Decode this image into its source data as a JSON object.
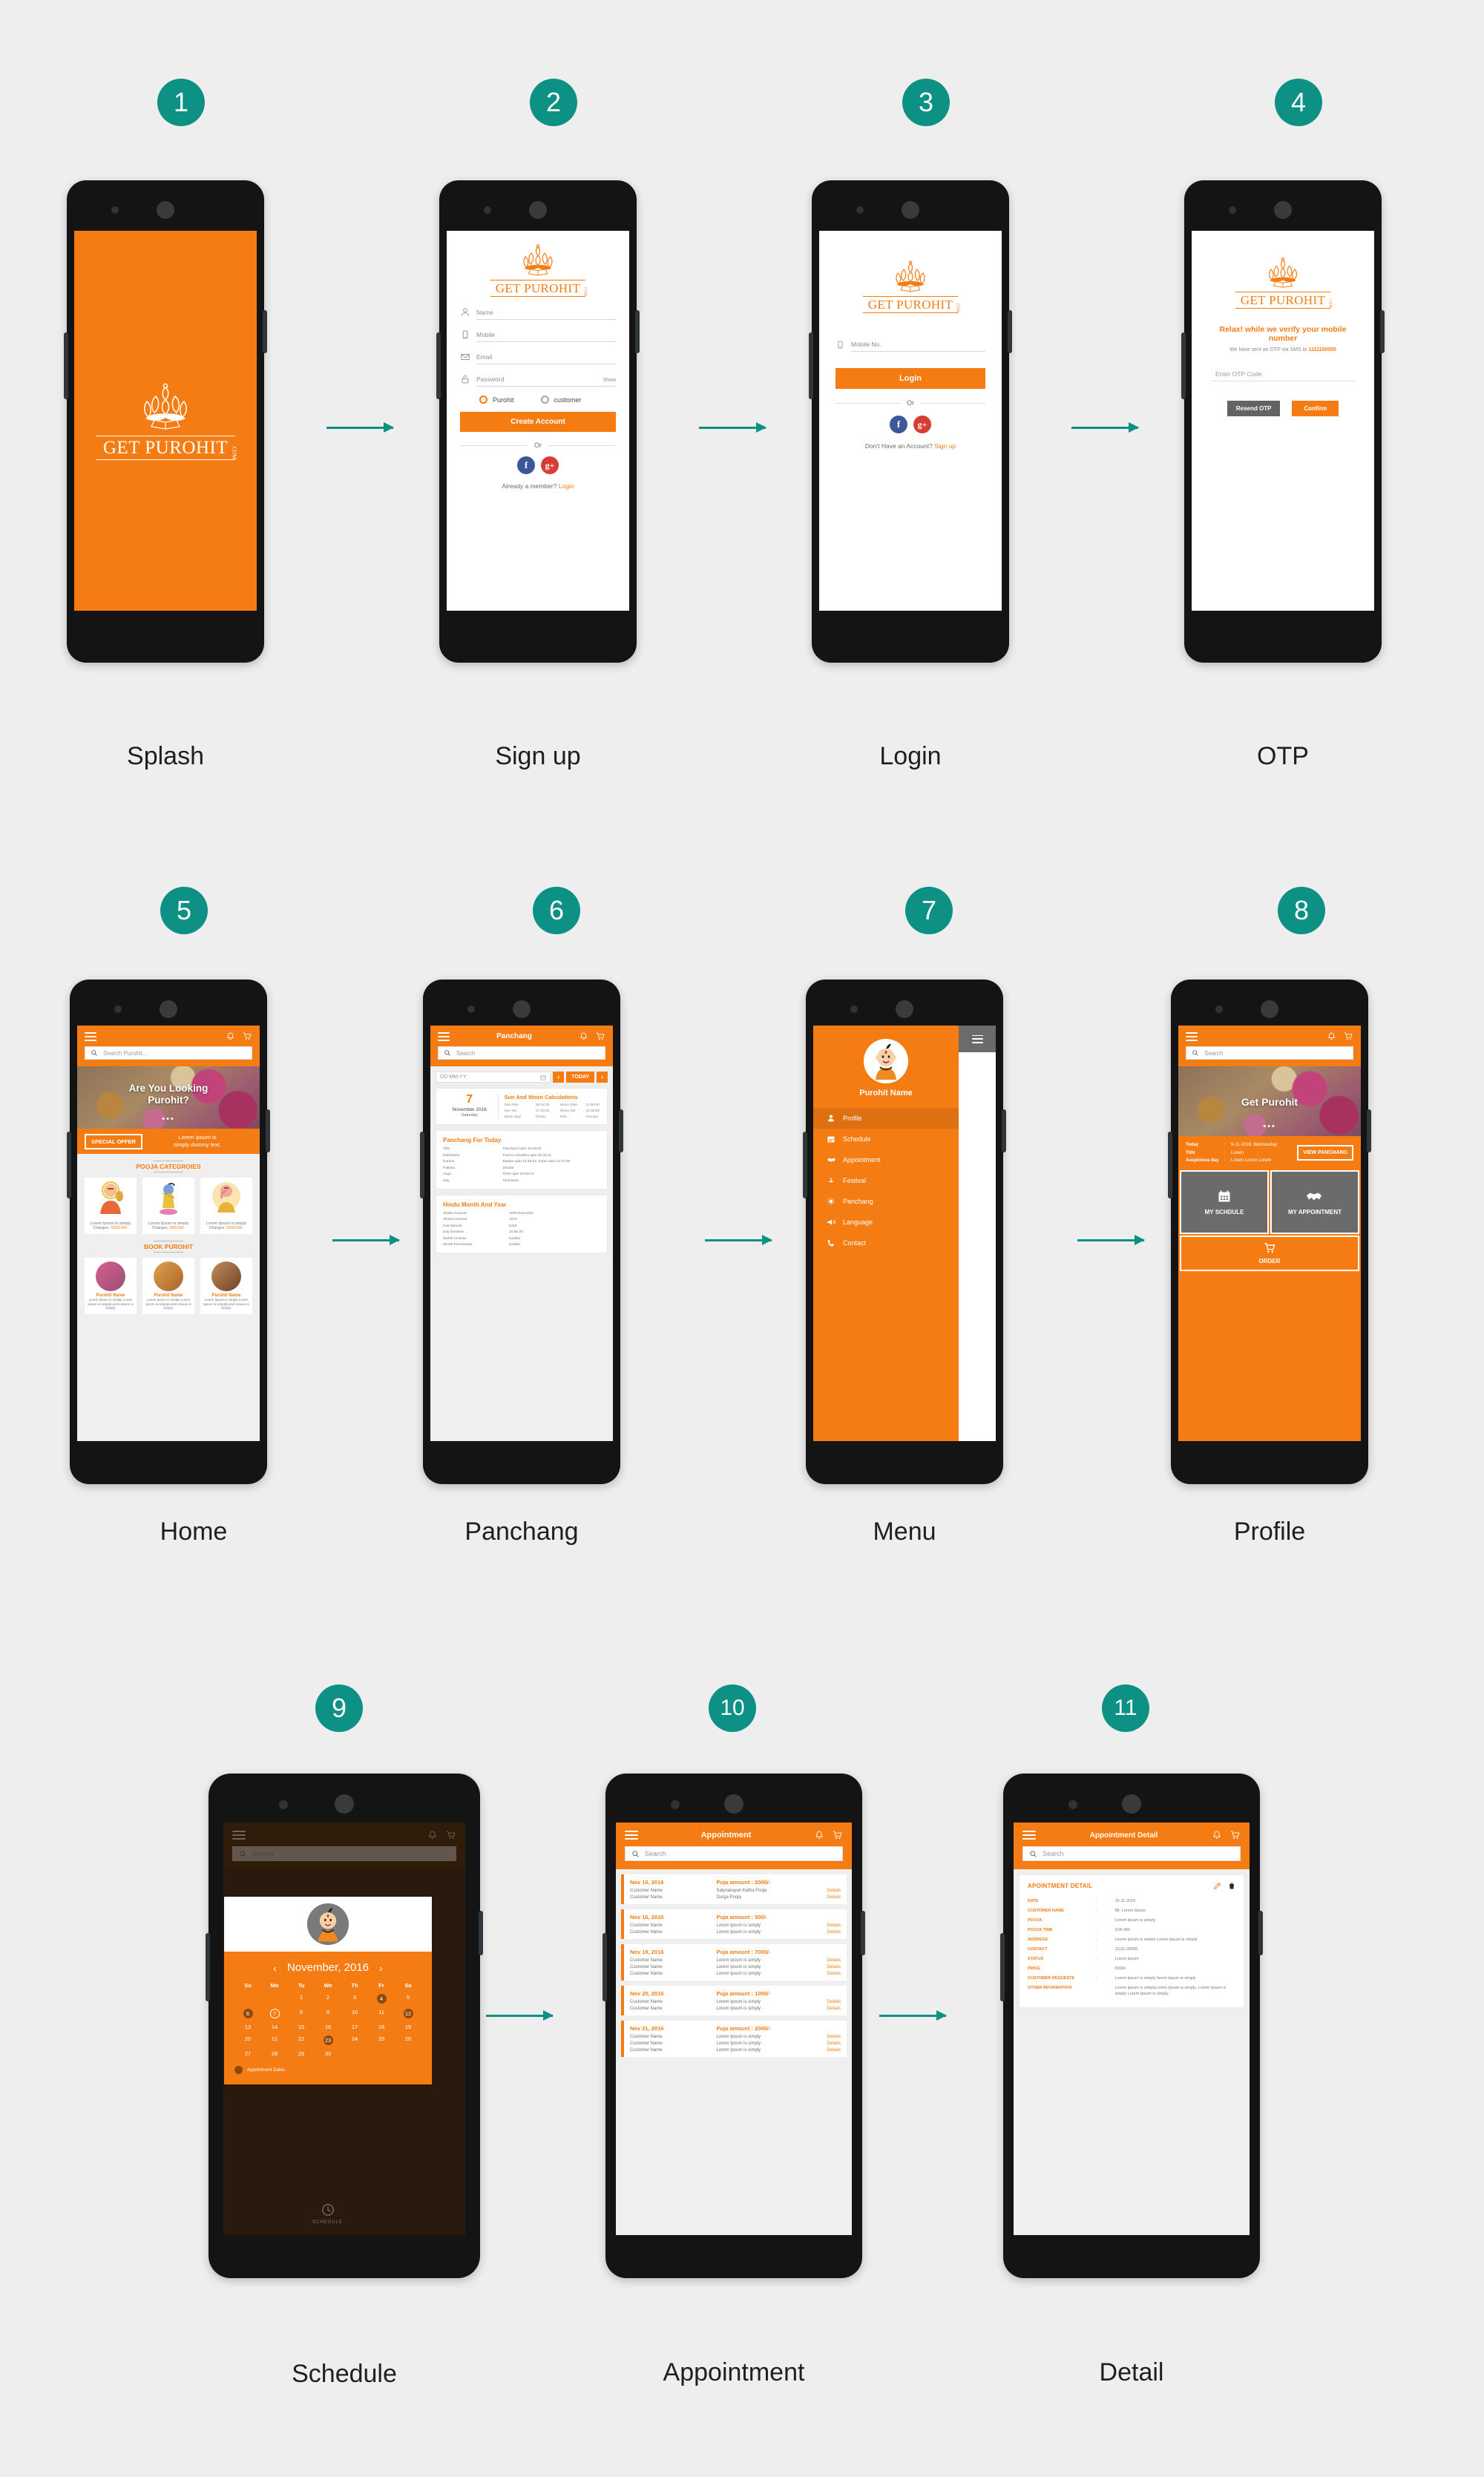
{
  "brand": {
    "accent_orange": "#f57c13",
    "teal": "#0d9184",
    "logo_word": "GET PUROHIT",
    "logo_suffix": ".COM"
  },
  "flow": [
    {
      "number": "1",
      "caption": "Splash"
    },
    {
      "number": "2",
      "caption": "Sign up"
    },
    {
      "number": "3",
      "caption": "Login"
    },
    {
      "number": "4",
      "caption": "OTP"
    },
    {
      "number": "5",
      "caption": "Home"
    },
    {
      "number": "6",
      "caption": "Panchang"
    },
    {
      "number": "7",
      "caption": "Menu"
    },
    {
      "number": "8",
      "caption": "Profile"
    },
    {
      "number": "9",
      "caption": "Schedule"
    },
    {
      "number": "10",
      "caption": "Appointment"
    },
    {
      "number": "11",
      "caption": "Detail"
    }
  ],
  "signup": {
    "fields": [
      {
        "icon": "user-icon",
        "placeholder": "Name"
      },
      {
        "icon": "mobile-icon",
        "placeholder": "Mobile"
      },
      {
        "icon": "envelope-icon",
        "placeholder": "Email"
      },
      {
        "icon": "lock-icon",
        "placeholder": "Password"
      }
    ],
    "show_label": "Show",
    "role_purohit": "Purohit",
    "role_customer": "customer",
    "create_button": "Create Account",
    "or_label": "Or",
    "social": [
      {
        "name": "facebook-icon",
        "glyph": "f"
      },
      {
        "name": "google-plus-icon",
        "glyph": "g+"
      }
    ],
    "footer_text": "Already a member?",
    "footer_link": "Login"
  },
  "login": {
    "mobile_placeholder": "Mobile No.",
    "login_button": "Login",
    "or_label": "Or",
    "social": [
      {
        "name": "facebook-icon",
        "glyph": "f"
      },
      {
        "name": "google-plus-icon",
        "glyph": "g+"
      }
    ],
    "footer_text": "Don't Have an Account?",
    "footer_link": "Sign up"
  },
  "otp": {
    "headline": "Relax! while we verify your mobile number",
    "subtext_prefix": "We have sent an OTP via SMS to",
    "number": "1111100000",
    "otp_placeholder": "Enter OTP Code",
    "resend_button": "Resend OTP",
    "confirm_button": "Confirm"
  },
  "home": {
    "search_placeholder": "Search Purohit...",
    "hero_title_line1": "Are You Looking",
    "hero_title_line2": "Purohit?",
    "offer_button": "SPECIAL OFFER",
    "offer_text_line1": "Lorem Ipsum is",
    "offer_text_line2": "simply dummy text.",
    "section_pooja": "POOJA CATEGROIES",
    "section_book": "BOOK PUROHIT",
    "pooja_cards": [
      {
        "deity": "hanuman",
        "desc": "Lorem Ipsum is simply",
        "charge_label": "Charges :",
        "charge": "1000.00/-"
      },
      {
        "deity": "krishna",
        "desc": "Lorem Ipsum is simply",
        "charge_label": "Charges :",
        "charge": "500.00/-"
      },
      {
        "deity": "ganesh",
        "desc": "Lorem Ipsum is simply",
        "charge_label": "Charges :",
        "charge": "1500.00/-"
      }
    ],
    "purohit_cards": [
      {
        "name": "Purohit Name",
        "desc": "Lorem Ipsum is simply Lorem Ipsum is simplyLorem Ipsum is simply."
      },
      {
        "name": "Purohit Name",
        "desc": "Lorem Ipsum is simply Lorem Ipsum is simplyLorem Ipsum is simply."
      },
      {
        "name": "Purohit Name",
        "desc": "Lorem Ipsum is simply Lorem Ipsum is simplyLorem Ipsum is simply."
      }
    ]
  },
  "panchang": {
    "title": "Panchang",
    "search_placeholder": "Search",
    "date_placeholder": "DD-MM-YY",
    "prev": "‹",
    "today": "TODAY",
    "next": "›",
    "day_number": "7",
    "month_year": "November 2016",
    "weekday": "Saturday",
    "sun_moon_title": "Sun And Moon Calculations",
    "sun_moon": [
      {
        "k": "Sun Rise",
        "v": "06:36:23",
        "k2": "Moon Rise",
        "v2": "11:00:00"
      },
      {
        "k": "Sun Set",
        "v": "17:32:53",
        "k2": "Moon Set",
        "v2": "21:56:59"
      },
      {
        "k": "Moon Sign",
        "v": "Dhanu",
        "k2": "Ritu",
        "v2": "Hemant"
      }
    ],
    "today_title": "Panchang For Today",
    "today_rows": [
      {
        "k": "Tithi",
        "v": "Panchami upto 10:49:22"
      },
      {
        "k": "Nakshatra",
        "v": "Poorva Ashadha upto 25:33:11"
      },
      {
        "k": "Karana",
        "v": "Baalav upto 10:49:22, Kolav  upto 23:37:36"
      },
      {
        "k": "Paksha",
        "v": "Shukla"
      },
      {
        "k": "Yoga",
        "v": "Dhriti upto 25:59:14"
      },
      {
        "k": "Day",
        "v": "Shanivara"
      }
    ],
    "hindu_title": "Hindu Month And Year",
    "hindu_rows": [
      {
        "k": "Shaka Samvat",
        "v": "1938   Durmukhi"
      },
      {
        "k": "Vikram Samvat",
        "v": "2073"
      },
      {
        "k": "Kali Samvat",
        "v": "5118"
      },
      {
        "k": "Day Duration",
        "v": "10:56:29"
      },
      {
        "k": "Month Amanta",
        "v": "Kartika"
      },
      {
        "k": "Month Purnimanta",
        "v": "Kartika"
      }
    ]
  },
  "menu": {
    "user_name": "Purohit Name",
    "items": [
      {
        "icon": "user-icon",
        "label": "Profile",
        "active": true
      },
      {
        "icon": "calendar-icon",
        "label": "Schedule",
        "active": false
      },
      {
        "icon": "handshake-icon",
        "label": "Appointment",
        "active": false
      },
      {
        "icon": "diya-lamp-icon",
        "label": "Festival",
        "active": false
      },
      {
        "icon": "sun-icon",
        "label": "Panchang",
        "active": false
      },
      {
        "icon": "megaphone-icon",
        "label": "Language",
        "active": false
      },
      {
        "icon": "phone-icon",
        "label": "Contact",
        "active": false
      }
    ]
  },
  "profile": {
    "search_placeholder": "Search",
    "hero_title": "Get Purohit",
    "info": [
      {
        "k": "Today",
        "v": "9-11-1016, Wednesday"
      },
      {
        "k": "Tithi",
        "v": "Lorem"
      },
      {
        "k": "Auspicious day",
        "v": "Lorem Lorem Lorem"
      }
    ],
    "view_panchang": "VIEW PANCHANG",
    "tiles": [
      {
        "icon": "calendar-icon",
        "label": "MY SCHDULE"
      },
      {
        "icon": "handshake-icon",
        "label": "MY APPOINTMENT"
      }
    ],
    "order_tile": {
      "icon": "cart-icon",
      "label": "ORDER"
    }
  },
  "schedule": {
    "search_placeholder": "Search",
    "month_year": "November, 2016",
    "prev": "‹",
    "next": "›",
    "dow": [
      "Su",
      "Mo",
      "Tu",
      "We",
      "Th",
      "Fr",
      "Sa"
    ],
    "lead_blanks": 2,
    "days": 30,
    "appointment_dates": [
      4,
      6,
      12,
      23
    ],
    "today": 7,
    "legend": "Appointment Dates",
    "bottom_label": "SCHEDULE"
  },
  "appointment": {
    "title": "Appointment",
    "search_placeholder": "Search",
    "details_label": "Details",
    "groups": [
      {
        "date": "Nov 15, 2016",
        "amount": "Puja amount : 2000/-",
        "rows": [
          {
            "customer": "Customer Name",
            "puja": "Satynarayan Katha Pooja"
          },
          {
            "customer": "Customer Name",
            "puja": "Durga Pooja"
          }
        ]
      },
      {
        "date": "Nov 16, 2016",
        "amount": "Puja amount : 500/-",
        "rows": [
          {
            "customer": "Customer Name",
            "puja": "Lorem Ipsum is simply"
          },
          {
            "customer": "Customer Name",
            "puja": "Lorem Ipsum is simply"
          }
        ]
      },
      {
        "date": "Nov 19, 2016",
        "amount": "Puja amount : 7000/-",
        "rows": [
          {
            "customer": "Customer Name",
            "puja": "Lorem Ipsum is simply"
          },
          {
            "customer": "Customer Name",
            "puja": "Lorem Ipsum is simply"
          },
          {
            "customer": "Customer Name",
            "puja": "Lorem Ipsum is simply"
          }
        ]
      },
      {
        "date": "Nov 20, 2016",
        "amount": "Puja amount : 1000/-",
        "rows": [
          {
            "customer": "Customer Name",
            "puja": "Lorem Ipsum is simply"
          },
          {
            "customer": "Customer Name",
            "puja": "Lorem Ipsum is simply"
          }
        ]
      },
      {
        "date": "Nov 21, 2016",
        "amount": "Puja amount : 2000/-",
        "rows": [
          {
            "customer": "Customer Name",
            "puja": "Lorem Ipsum is simply"
          },
          {
            "customer": "Customer Name",
            "puja": "Lorem Ipsum is simply"
          },
          {
            "customer": "Customer Name",
            "puja": "Lorem Ipsum is simply"
          }
        ]
      }
    ]
  },
  "detail": {
    "title": "Appointment Detail",
    "search_placeholder": "Search",
    "panel_title": "APOINTMENT DETAIL",
    "rows": [
      {
        "k": "DATE",
        "v": "15-11-2016"
      },
      {
        "k": "CUSTOMER NAME",
        "v": "Mr. Lorem Ipsum"
      },
      {
        "k": "POOJA",
        "v": "Lorem Ipsum is simply"
      },
      {
        "k": "POOJA TIME",
        "v": "9:00 AM"
      },
      {
        "k": "ADDRESS",
        "v": "Lorem Ipsum is simply Lorem Ipsum is simply"
      },
      {
        "k": "CONTACT",
        "v": "11111-00000"
      },
      {
        "k": "STATUS",
        "v": "Lorem Ipsum"
      },
      {
        "k": "PRICE",
        "v": "5000/-"
      },
      {
        "k": "CUSTOMER REQUESTE",
        "v": "Lorem Ipsum is simply lorem Ipsum is simply"
      },
      {
        "k": "OTHER INFORMATION",
        "v": "Lorem Ipsum is simplyLorem Ipsum is simply. Lorem Ipsum is simply Lorem Ipsum is simply."
      }
    ]
  }
}
